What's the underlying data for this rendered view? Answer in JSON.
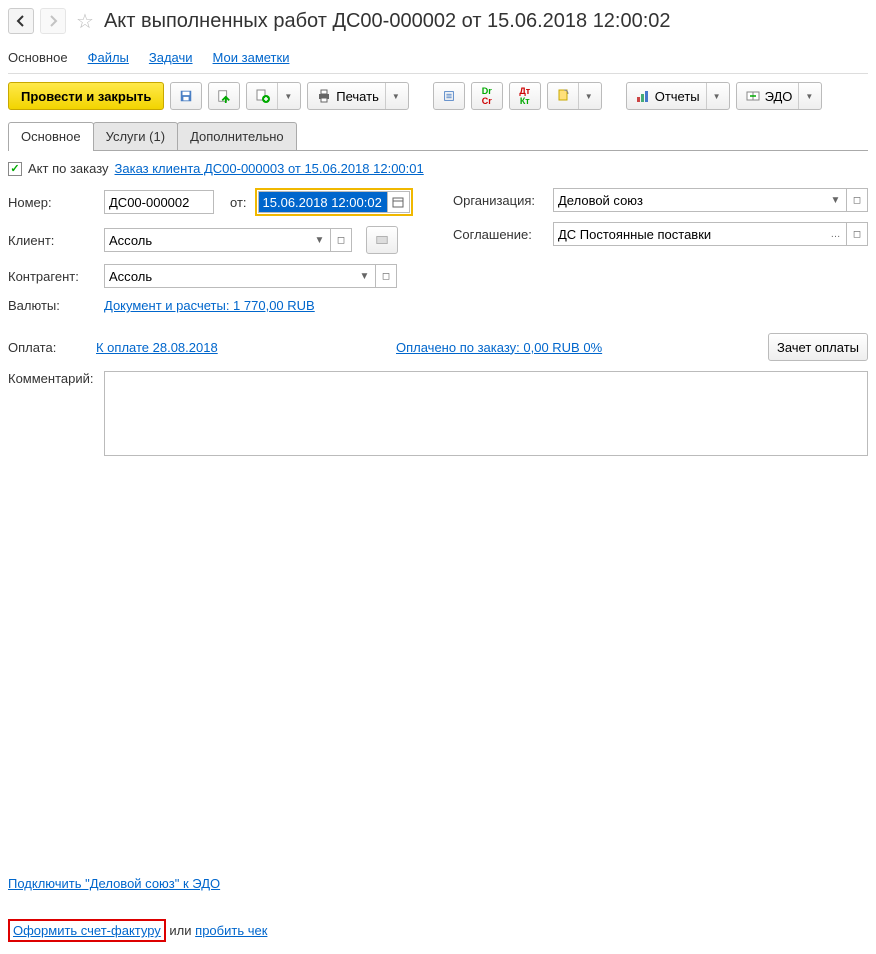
{
  "header": {
    "title": "Акт выполненных работ ДС00-000002 от 15.06.2018 12:00:02"
  },
  "topNav": {
    "main": "Основное",
    "files": "Файлы",
    "tasks": "Задачи",
    "notes": "Мои заметки"
  },
  "toolbar": {
    "postClose": "Провести и закрыть",
    "print": "Печать",
    "reports": "Отчеты",
    "edo": "ЭДО"
  },
  "tabs": {
    "main": "Основное",
    "services": "Услуги (1)",
    "extra": "Дополнительно"
  },
  "form": {
    "actByOrderLabel": "Акт по заказу",
    "orderLink": "Заказ клиента ДС00-000003 от 15.06.2018 12:00:01",
    "numberLabel": "Номер:",
    "numberValue": "ДС00-000002",
    "dateLabel": "от:",
    "dateValue": "15.06.2018 12:00:02",
    "orgLabel": "Организация:",
    "orgValue": "Деловой союз",
    "clientLabel": "Клиент:",
    "clientValue": "Ассоль",
    "agreementLabel": "Соглашение:",
    "agreementValue": "ДС Постоянные поставки",
    "contractorLabel": "Контрагент:",
    "contractorValue": "Ассоль",
    "currencyLabel": "Валюты:",
    "currencyLink": "Документ и расчеты: 1 770,00 RUB",
    "paymentLabel": "Оплата:",
    "paymentLink": "К оплате 28.08.2018",
    "paidLink": "Оплачено по заказу: 0,00 RUB  0%",
    "offsetBtn": "Зачет оплаты",
    "commentLabel": "Комментарий:"
  },
  "footer": {
    "edoLink": "Подключить \"Деловой союз\" к ЭДО",
    "invoiceLink": "Оформить счет-фактуру",
    "or": " или ",
    "receiptLink": "пробить чек"
  }
}
